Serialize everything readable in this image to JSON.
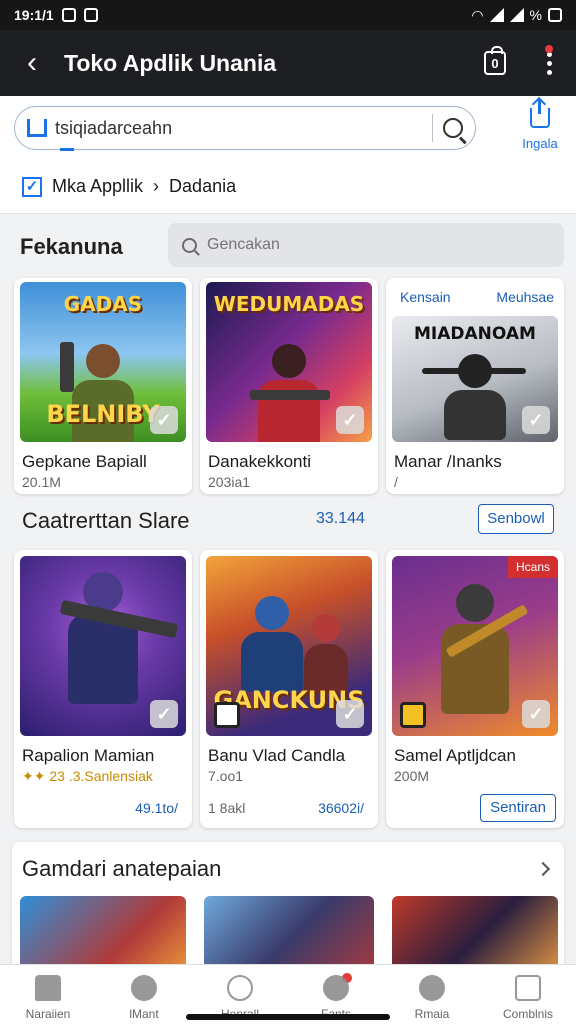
{
  "status_bar": {
    "time": "19:1/1",
    "right_text": "%"
  },
  "app_bar": {
    "title": "Toko Apdlik Unania",
    "bag_count": "0"
  },
  "search": {
    "value": "tsiqiadarceahn",
    "share_label": "Ingala"
  },
  "breadcrumb": {
    "part1": "Mka Appllik",
    "separator": "›",
    "part2": "Dadania"
  },
  "featured": {
    "title": "Fekanuna",
    "filter_placeholder": "Gencakan",
    "cards": [
      {
        "art_title": "GADAS",
        "art_bottom": "BELNIBY",
        "name": "Gepkane Bapiall",
        "sub": "20.1M",
        "colors": [
          "#3f8fd8",
          "#6fbe3b"
        ]
      },
      {
        "art_title": "WEDUMADAS",
        "art_bottom": "",
        "name": "Danakekkonti",
        "sub": "203ia1",
        "colors": [
          "#1c1a52",
          "#d64062"
        ]
      },
      {
        "art_title": "MIADANOAM",
        "art_bottom": "",
        "name": "Manar /Inanks",
        "sub": "/",
        "top_left": "Kensain",
        "top_right": "Meuhsae",
        "colors": [
          "#c9ccd2",
          "#5e636c"
        ]
      }
    ]
  },
  "second": {
    "title": "Caatrerttan Slare",
    "count": "33.144",
    "button": "Senbowl",
    "cards": [
      {
        "name": "Rapalion Mamian",
        "sub": "✦✦ 23 .3.Sanlensiak",
        "link": "49.1to/",
        "colors": [
          "#2b1e6e",
          "#8a3ec6"
        ]
      },
      {
        "name": "Banu Vlad Candla",
        "sub": "7.oo1",
        "sub2": "1 8akl",
        "link": "36602i/",
        "art_bottom": "GANCKUNS",
        "colors": [
          "#f2a33a",
          "#3b2a7a"
        ]
      },
      {
        "name": "Samel Aptljdcan",
        "sub": "200M",
        "button": "Sentiran",
        "tag": "Hcans",
        "colors": [
          "#6a2f8f",
          "#ef8c2b"
        ]
      }
    ]
  },
  "third": {
    "title": "Gamdari anatepaian"
  },
  "bottom_nav": [
    {
      "label": "Naraiien"
    },
    {
      "label": "lMant"
    },
    {
      "label": "Henrall"
    },
    {
      "label": "Fants"
    },
    {
      "label": "Rmaia"
    },
    {
      "label": "Comblnis"
    }
  ]
}
